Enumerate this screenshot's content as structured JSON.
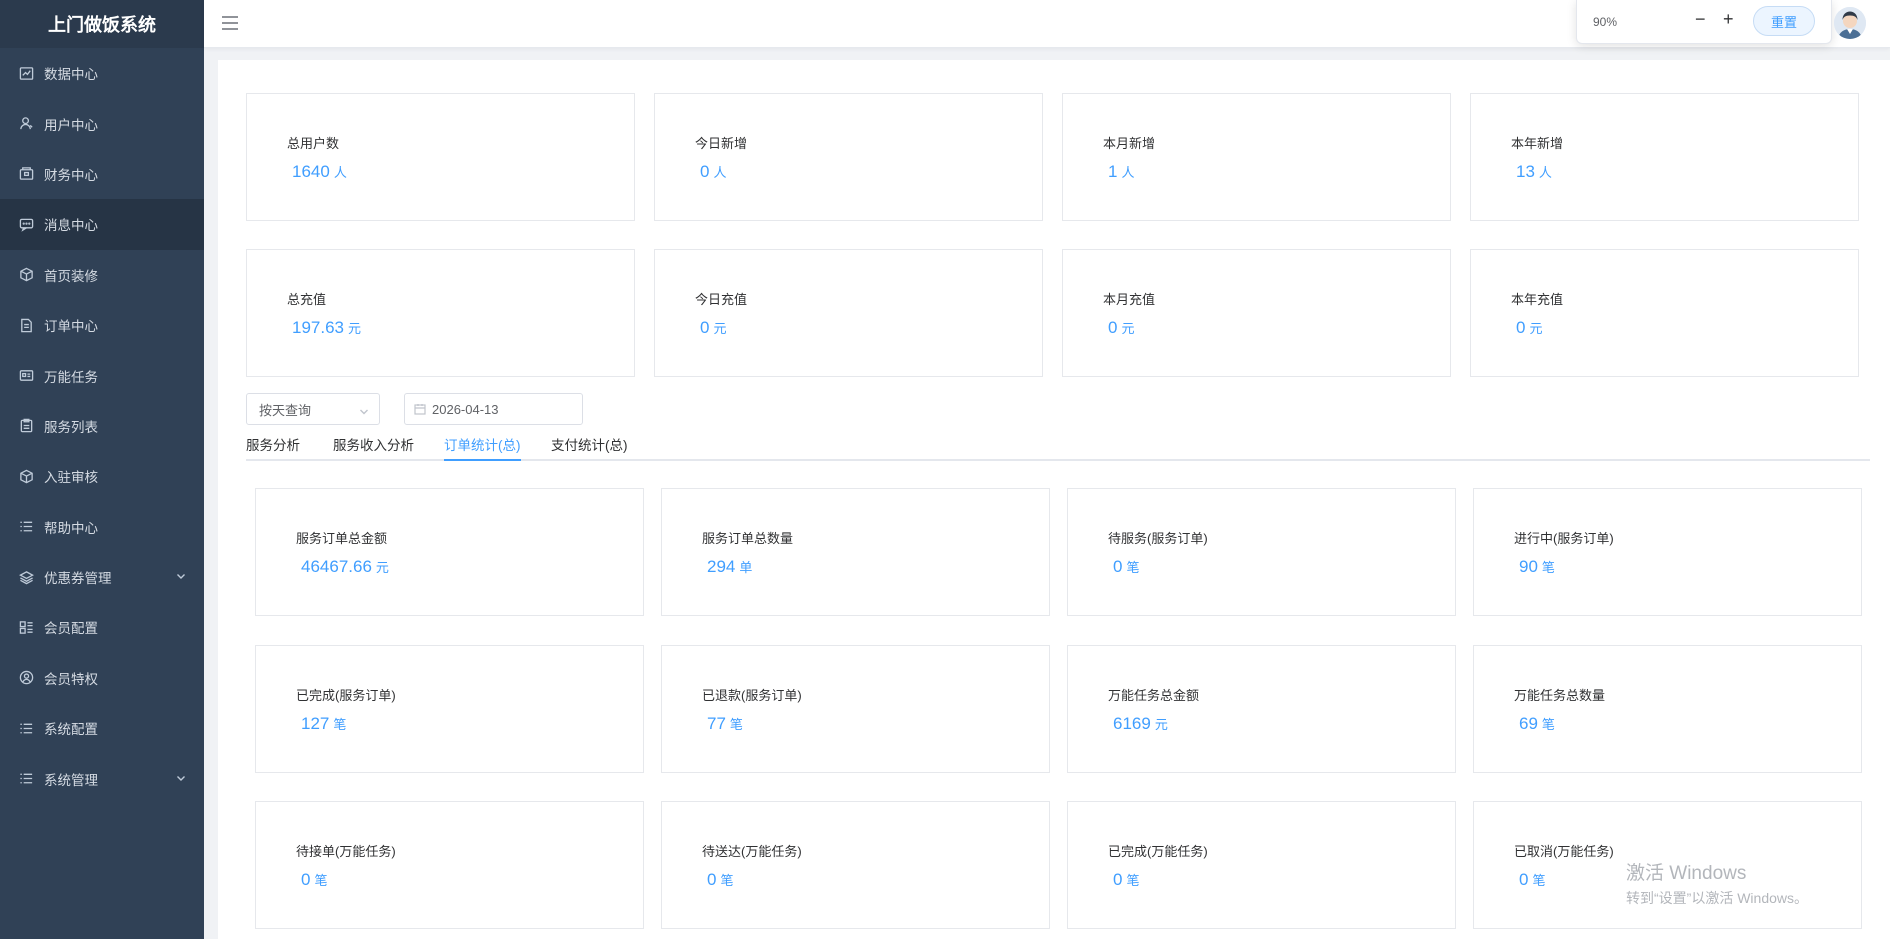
{
  "app": {
    "title": "上门做饭系统"
  },
  "sidebar": {
    "items": [
      {
        "label": "数据中心",
        "icon": "chart-icon"
      },
      {
        "label": "用户中心",
        "icon": "user-icon"
      },
      {
        "label": "财务中心",
        "icon": "wallet-icon"
      },
      {
        "label": "消息中心",
        "icon": "message-icon"
      },
      {
        "label": "首页装修",
        "icon": "cube-icon"
      },
      {
        "label": "订单中心",
        "icon": "document-icon"
      },
      {
        "label": "万能任务",
        "icon": "id-card-icon"
      },
      {
        "label": "服务列表",
        "icon": "clipboard-icon"
      },
      {
        "label": "入驻审核",
        "icon": "box-icon"
      },
      {
        "label": "帮助中心",
        "icon": "list-icon"
      },
      {
        "label": "优惠券管理",
        "icon": "layers-icon"
      },
      {
        "label": "会员配置",
        "icon": "grid-list-icon"
      },
      {
        "label": "会员特权",
        "icon": "face-icon"
      },
      {
        "label": "系统配置",
        "icon": "list-icon"
      },
      {
        "label": "系统管理",
        "icon": "list-icon"
      }
    ],
    "active_index": 3
  },
  "topbar": {
    "zoom_value": "90%",
    "zoom_minus": "−",
    "zoom_plus": "+",
    "reset_label": "重置"
  },
  "user_stats": [
    {
      "label": "总用户数",
      "value": "1640",
      "unit": "人"
    },
    {
      "label": "今日新增",
      "value": "0",
      "unit": "人"
    },
    {
      "label": "本月新增",
      "value": "1",
      "unit": "人"
    },
    {
      "label": "本年新增",
      "value": "13",
      "unit": "人"
    }
  ],
  "recharge_stats": [
    {
      "label": "总充值",
      "value": "197.63",
      "unit": "元"
    },
    {
      "label": "今日充值",
      "value": "0",
      "unit": "元"
    },
    {
      "label": "本月充值",
      "value": "0",
      "unit": "元"
    },
    {
      "label": "本年充值",
      "value": "0",
      "unit": "元"
    }
  ],
  "filter": {
    "mode_value": "按天查询",
    "date_value": "2026-04-13"
  },
  "tabs": [
    {
      "label": "服务分析"
    },
    {
      "label": "服务收入分析"
    },
    {
      "label": "订单统计(总)"
    },
    {
      "label": "支付统计(总)"
    }
  ],
  "active_tab": 2,
  "order_stats": [
    {
      "label": "服务订单总金额",
      "value": "46467.66",
      "unit": "元"
    },
    {
      "label": "服务订单总数量",
      "value": "294",
      "unit": "单"
    },
    {
      "label": "待服务(服务订单)",
      "value": "0",
      "unit": "笔"
    },
    {
      "label": "进行中(服务订单)",
      "value": "90",
      "unit": "笔"
    },
    {
      "label": "已完成(服务订单)",
      "value": "127",
      "unit": "笔"
    },
    {
      "label": "已退款(服务订单)",
      "value": "77",
      "unit": "笔"
    },
    {
      "label": "万能任务总金额",
      "value": "6169",
      "unit": "元"
    },
    {
      "label": "万能任务总数量",
      "value": "69",
      "unit": "笔"
    },
    {
      "label": "待接单(万能任务)",
      "value": "0",
      "unit": "笔"
    },
    {
      "label": "待送达(万能任务)",
      "value": "0",
      "unit": "笔"
    },
    {
      "label": "已完成(万能任务)",
      "value": "0",
      "unit": "笔"
    },
    {
      "label": "已取消(万能任务)",
      "value": "0",
      "unit": "笔"
    }
  ],
  "watermark": {
    "line1": "激活 Windows",
    "line2": "转到“设置”以激活 Windows。"
  },
  "colors": {
    "sidebar_bg": "#304156",
    "accent": "#409eff"
  }
}
